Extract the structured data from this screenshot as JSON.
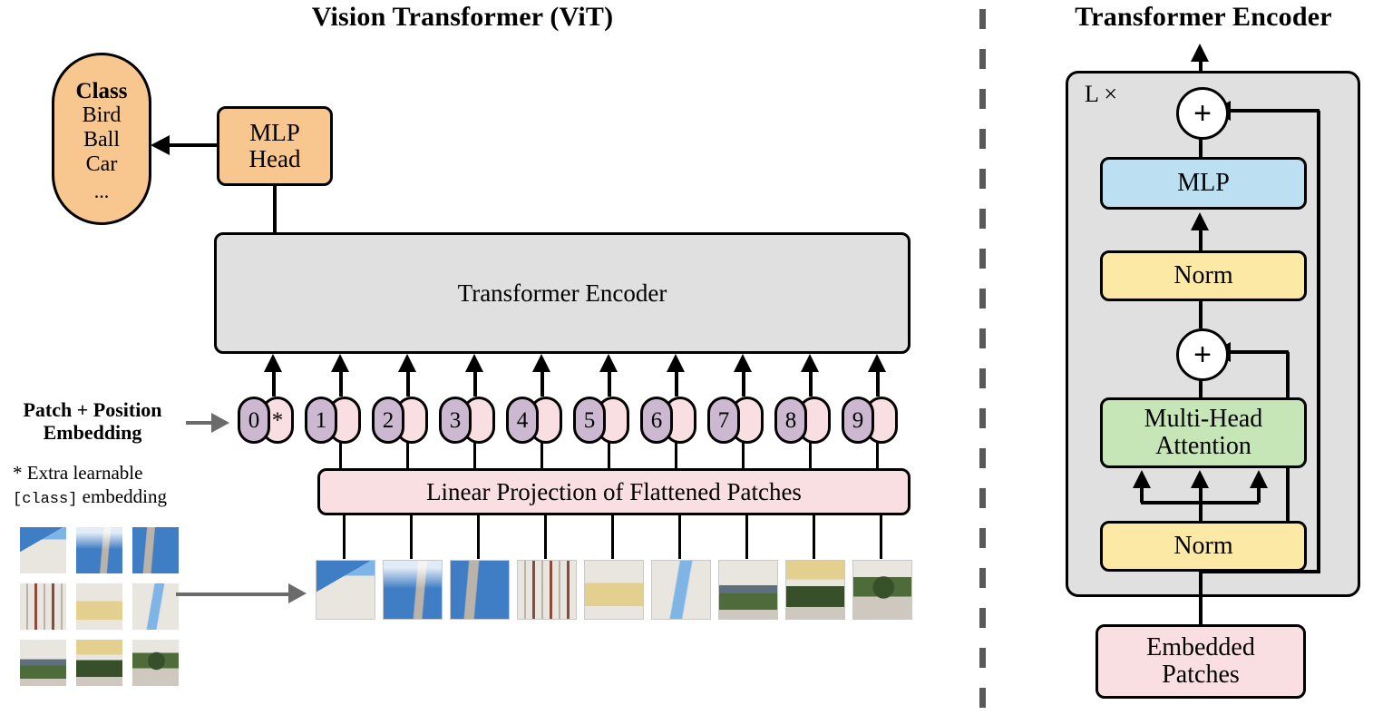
{
  "figure": {
    "left_title": "Vision Transformer (ViT)",
    "right_title": "Transformer Encoder"
  },
  "left_panel": {
    "class_box": {
      "heading": "Class",
      "items": [
        "Bird",
        "Ball",
        "Car"
      ],
      "ellipsis": "...",
      "color": "#f8c68f"
    },
    "mlp_head": {
      "line1": "MLP",
      "line2": "Head",
      "color": "#f8c68f"
    },
    "encoder_box": {
      "label": "Transformer Encoder",
      "color": "#e0e0e0"
    },
    "linear_projection": {
      "label": "Linear Projection of Flattened Patches",
      "color": "#fadfe2"
    },
    "patch_position_label": {
      "line1": "Patch + Position",
      "line2": "Embedding"
    },
    "footnote": {
      "star": "*",
      "line1": "Extra learnable",
      "code": "[class]",
      "line1b": "embedding"
    },
    "tokens": [
      {
        "num": "0",
        "extra": "*"
      },
      {
        "num": "1",
        "extra": ""
      },
      {
        "num": "2",
        "extra": ""
      },
      {
        "num": "3",
        "extra": ""
      },
      {
        "num": "4",
        "extra": ""
      },
      {
        "num": "5",
        "extra": ""
      },
      {
        "num": "6",
        "extra": ""
      },
      {
        "num": "7",
        "extra": ""
      },
      {
        "num": "8",
        "extra": ""
      },
      {
        "num": "9",
        "extra": ""
      }
    ],
    "token_colors": {
      "number": "#cdb8d2",
      "embedding": "#fadfe2"
    },
    "source_image_grid_rows": 3,
    "source_image_grid_cols": 3,
    "patch_sequence_count": 9
  },
  "right_panel": {
    "repeat_label": "L ×",
    "container_color": "#e0e0e0",
    "blocks": [
      {
        "label": "MLP",
        "color": "#bcdff1"
      },
      {
        "label": "Norm",
        "color": "#fce9a6"
      },
      {
        "label": "Multi-Head\nAttention",
        "line1": "Multi-Head",
        "line2": "Attention",
        "color": "#c6e6b8"
      },
      {
        "label": "Norm",
        "color": "#fce9a6"
      },
      {
        "line1": "Embedded",
        "line2": "Patches",
        "color": "#fadfe2"
      }
    ],
    "residual_add_symbol": "+",
    "attention_input_arrows": 3
  },
  "divider": {
    "color": "#595959",
    "style": "dashed-vertical"
  }
}
